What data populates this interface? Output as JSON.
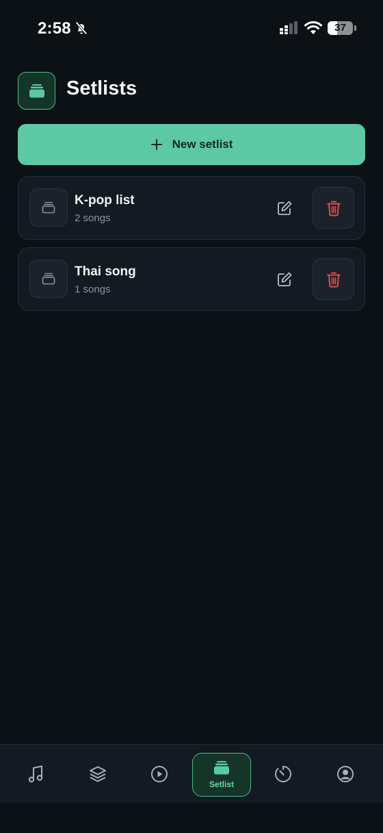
{
  "status_bar": {
    "time": "2:58",
    "battery_level": "37",
    "battery_fraction": 0.37,
    "icons": [
      "bell-slash-icon",
      "cellular-signal-icon",
      "wifi-icon",
      "battery-icon"
    ]
  },
  "header": {
    "title": "Setlists",
    "logo_icon": "stack-icon"
  },
  "actions": {
    "new_setlist_label": "New setlist",
    "new_setlist_icon": "plus-icon"
  },
  "setlists": [
    {
      "title": "K-pop list",
      "subtitle": "2 songs"
    },
    {
      "title": "Thai song",
      "subtitle": "1 songs"
    }
  ],
  "bottom_nav": {
    "items": [
      "music-note-icon",
      "layers-icon",
      "play-circle-icon",
      "setlist-icon",
      "timer-icon",
      "user-circle-icon"
    ],
    "active_label": "Setlist"
  },
  "colors": {
    "background": "#0c1116",
    "accent": "#5cc9a4",
    "card": "#141a22",
    "danger": "#e5484d",
    "muted_text": "#8a939d"
  }
}
